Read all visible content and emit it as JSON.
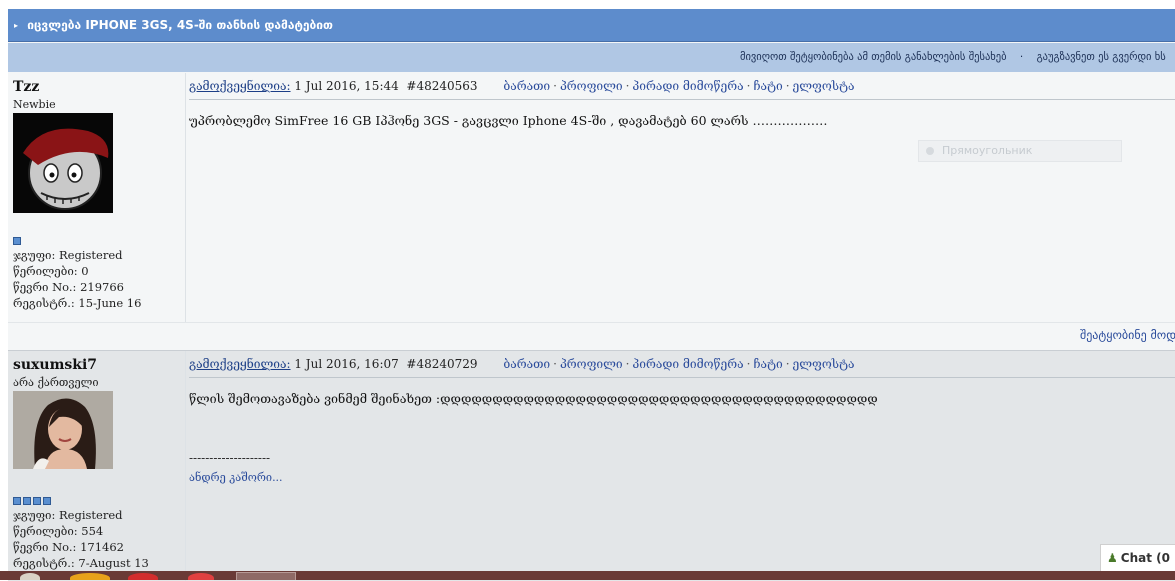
{
  "topic": {
    "title": "იცვლება IPHONE 3GS, 4S-ში თანხის დამატებით"
  },
  "actions": {
    "notify": "მივიღოთ შეტყობინება ამ თემის განახლების შესახებ",
    "send": "გაუგზავნეთ ეს გვერდი ხს"
  },
  "posts": [
    {
      "username": "Tzz",
      "usertitle": "Newbie",
      "group": "ჯგუფი: Registered",
      "posts_count": "წერილები: 0",
      "member_no": "წევრი No.: 219766",
      "registered": "რეგისტრ.: 15-June 16",
      "posted_label": "გამოქვეყნილია:",
      "date": "1 Jul 2016, 15:44",
      "post_id": "#48240563",
      "links": [
        "ბარათი",
        "პროფილი",
        "პირადი მიმოწერა",
        "ჩატი",
        "ელფოსტა"
      ],
      "text": "უპრობლემო SimFree 16 GB Iპჰონე 3GS - გავცვლი Iphone 4S-ში , დავამატებ 60 ლარს ………………",
      "pips": 1
    },
    {
      "username": "suxumski7",
      "usertitle": "არა ქართველი",
      "group": "ჯგუფი: Registered",
      "posts_count": "წერილები: 554",
      "member_no": "წევრი No.: 171462",
      "registered": "რეგისტრ.: 7-August 13",
      "posted_label": "გამოქვეყნილია:",
      "date": "1 Jul 2016, 16:07",
      "post_id": "#48240729",
      "links": [
        "ბარათი",
        "პროფილი",
        "პირადი მიმოწერა",
        "ჩატი",
        "ელფოსტა"
      ],
      "text": "წლის შემოთავაზება ვინმემ შეინახეთ :დდდდდდდდდდდდდდდდდდდდდდდდდდდდდდდდდდდდდდდდდდ",
      "signature_sep": "--------------------",
      "signature": "ანდრე კაშორი...",
      "pips": 4
    }
  ],
  "report": {
    "label": "შეატყობინე მოდ"
  },
  "ghost": {
    "placeholder": "Прямоугольник"
  },
  "chat": {
    "label": "Chat (0"
  },
  "colors": {
    "topic_bar": "#5d8ccc",
    "action_bar": "#b0c7e4",
    "link": "#2a4b9b"
  }
}
